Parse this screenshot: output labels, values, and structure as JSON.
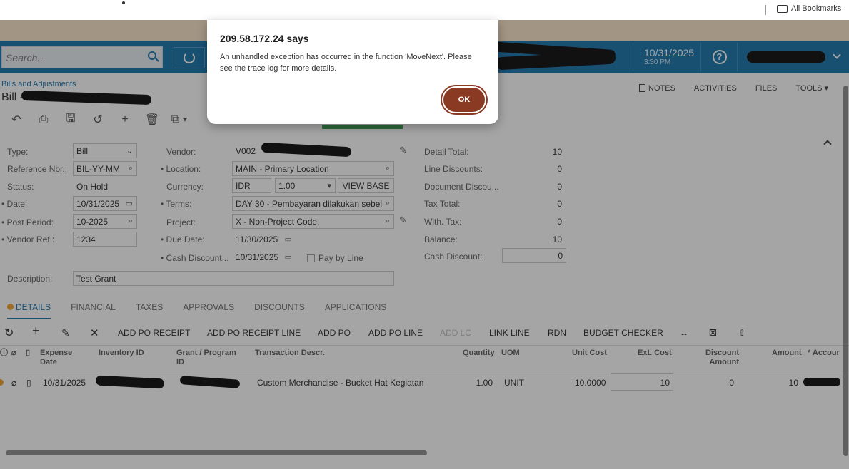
{
  "browser": {
    "bookmarks_label": "All Bookmarks"
  },
  "header": {
    "search_placeholder": "Search...",
    "date": "10/31/2025",
    "time": "3:30 PM",
    "help_symbol": "?"
  },
  "page": {
    "breadcrumb": "Bills and Adjustments",
    "title": "Bill - T",
    "actions": [
      "NOTES",
      "ACTIVITIES",
      "FILES",
      "TOOLS ▾"
    ]
  },
  "form": {
    "type_label": "Type:",
    "type_value": "Bill",
    "refnbr_label": "Reference Nbr.:",
    "refnbr_value": "BIL-YY-MM",
    "status_label": "Status:",
    "status_value": "On Hold",
    "date_label": "Date:",
    "date_value": "10/31/2025",
    "postperiod_label": "Post Period:",
    "postperiod_value": "10-2025",
    "vendorref_label": "Vendor Ref.:",
    "vendorref_value": "1234",
    "vendor_label": "Vendor:",
    "vendor_value": "V002",
    "location_label": "Location:",
    "location_value": "MAIN - Primary Location",
    "currency_label": "Currency:",
    "currency_value": "IDR",
    "currency_rate": "1.00",
    "view_base": "VIEW BASE",
    "terms_label": "Terms:",
    "terms_value": "DAY 30 - Pembayaran dilakukan sebel",
    "project_label": "Project:",
    "project_value": "X - Non-Project Code.",
    "duedate_label": "Due Date:",
    "duedate_value": "11/30/2025",
    "cashdisc_label": "Cash Discount...",
    "cashdisc_value": "10/31/2025",
    "paybyline_label": "Pay by Line",
    "description_label": "Description:",
    "description_value": "Test Grant"
  },
  "totals": {
    "detail_total_label": "Detail Total:",
    "detail_total": "10",
    "line_discounts_label": "Line Discounts:",
    "line_discounts": "0",
    "document_discount_label": "Document Discou...",
    "document_discount": "0",
    "tax_total_label": "Tax Total:",
    "tax_total": "0",
    "with_tax_label": "With. Tax:",
    "with_tax": "0",
    "balance_label": "Balance:",
    "balance": "10",
    "cash_discount_label": "Cash Discount:",
    "cash_discount": "0"
  },
  "tabs": [
    "DETAILS",
    "FINANCIAL",
    "TAXES",
    "APPROVALS",
    "DISCOUNTS",
    "APPLICATIONS"
  ],
  "grid_toolbar": {
    "add_po_receipt": "ADD PO RECEIPT",
    "add_po_receipt_line": "ADD PO RECEIPT LINE",
    "add_po": "ADD PO",
    "add_po_line": "ADD PO LINE",
    "add_lc": "ADD LC",
    "link_line": "LINK LINE",
    "rdn": "RDN",
    "budget_checker": "BUDGET CHECKER"
  },
  "grid": {
    "columns": {
      "expense_date": "Expense Date",
      "inventory_id": "Inventory ID",
      "grant_program": "Grant / Program ID",
      "transaction_descr": "Transaction Descr.",
      "quantity": "Quantity",
      "uom": "UOM",
      "unit_cost": "Unit Cost",
      "ext_cost": "Ext. Cost",
      "discount_amount": "Discount Amount",
      "amount": "Amount",
      "account": "* Accour"
    },
    "rows": [
      {
        "expense_date": "10/31/2025",
        "transaction_descr": "Custom Merchandise - Bucket Hat Kegiatan",
        "quantity": "1.00",
        "uom": "UNIT",
        "unit_cost": "10.0000",
        "ext_cost": "10",
        "discount_amount": "0",
        "amount": "10"
      }
    ]
  },
  "dialog": {
    "title": "209.58.172.24 says",
    "message": "An unhandled exception has occurred in the function 'MoveNext'. Please see the trace log for more details.",
    "ok_label": "OK"
  }
}
